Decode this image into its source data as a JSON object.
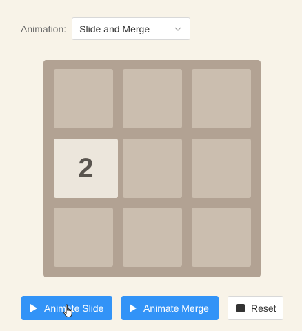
{
  "animation": {
    "label": "Animation:",
    "selected": "Slide and Merge"
  },
  "board": {
    "tiles": [
      {
        "row": 1,
        "col": 0,
        "value": "2"
      }
    ]
  },
  "buttons": {
    "slide_label": "Animate Slide",
    "merge_label": "Animate Merge",
    "reset_label": "Reset"
  },
  "colors": {
    "background": "#f8f3e8",
    "board": "#b2a293",
    "cell": "#cbbeaf",
    "tile": "#ece6dc",
    "accent": "#3293f7"
  }
}
